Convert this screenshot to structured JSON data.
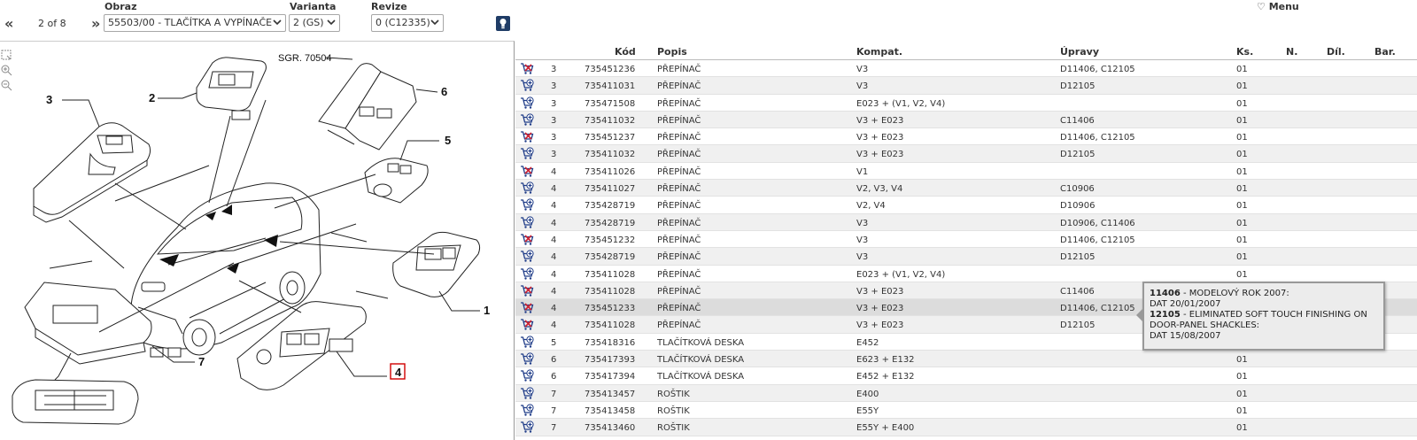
{
  "toolbar": {
    "obraz_label": "Obraz",
    "varianta_label": "Varianta",
    "revize_label": "Revize",
    "prev": "«",
    "next": "»",
    "page": "2 of 8",
    "obraz_value": "55503/00 - TLAČÍTKA A VYPÍNAČE",
    "varianta_value": "2 (GS)",
    "revize_value": "0 (C12335)",
    "menu": "♡ Menu"
  },
  "drawing": {
    "title": "SGR. 70504",
    "callouts": [
      "3",
      "2",
      "6",
      "5",
      "1",
      "7",
      "4"
    ]
  },
  "table": {
    "headers": {
      "code": "Kód",
      "desc": "Popis",
      "comp": "Kompat.",
      "mod": "Úpravy",
      "qty": "Ks.",
      "n": "N.",
      "dil": "Díl.",
      "bar": "Bar."
    },
    "rows": [
      {
        "pos": "3",
        "code": "735451236",
        "desc": "PŘEPÍNAČ",
        "comp": "V3",
        "mod": "D11406, C12105",
        "qty": "01",
        "cart": "x"
      },
      {
        "pos": "3",
        "code": "735411031",
        "desc": "PŘEPÍNAČ",
        "comp": "V3",
        "mod": "D12105",
        "qty": "01",
        "cart": "plus"
      },
      {
        "pos": "3",
        "code": "735471508",
        "desc": "PŘEPÍNAČ",
        "comp": "E023 + (V1, V2, V4)",
        "mod": "",
        "qty": "01",
        "cart": "plus"
      },
      {
        "pos": "3",
        "code": "735411032",
        "desc": "PŘEPÍNAČ",
        "comp": "V3 + E023",
        "mod": "C11406",
        "qty": "01",
        "cart": "plus"
      },
      {
        "pos": "3",
        "code": "735451237",
        "desc": "PŘEPÍNAČ",
        "comp": "V3 + E023",
        "mod": "D11406, C12105",
        "qty": "01",
        "cart": "x"
      },
      {
        "pos": "3",
        "code": "735411032",
        "desc": "PŘEPÍNAČ",
        "comp": "V3 + E023",
        "mod": "D12105",
        "qty": "01",
        "cart": "plus"
      },
      {
        "pos": "4",
        "code": "735411026",
        "desc": "PŘEPÍNAČ",
        "comp": "V1",
        "mod": "",
        "qty": "01",
        "cart": "x"
      },
      {
        "pos": "4",
        "code": "735411027",
        "desc": "PŘEPÍNAČ",
        "comp": "V2, V3, V4",
        "mod": "C10906",
        "qty": "01",
        "cart": "plus"
      },
      {
        "pos": "4",
        "code": "735428719",
        "desc": "PŘEPÍNAČ",
        "comp": "V2, V4",
        "mod": "D10906",
        "qty": "01",
        "cart": "plus"
      },
      {
        "pos": "4",
        "code": "735428719",
        "desc": "PŘEPÍNAČ",
        "comp": "V3",
        "mod": "D10906, C11406",
        "qty": "01",
        "cart": "plus"
      },
      {
        "pos": "4",
        "code": "735451232",
        "desc": "PŘEPÍNAČ",
        "comp": "V3",
        "mod": "D11406, C12105",
        "qty": "01",
        "cart": "x"
      },
      {
        "pos": "4",
        "code": "735428719",
        "desc": "PŘEPÍNAČ",
        "comp": "V3",
        "mod": "D12105",
        "qty": "01",
        "cart": "plus"
      },
      {
        "pos": "4",
        "code": "735411028",
        "desc": "PŘEPÍNAČ",
        "comp": "E023 + (V1, V2, V4)",
        "mod": "",
        "qty": "01",
        "cart": "plus"
      },
      {
        "pos": "4",
        "code": "735411028",
        "desc": "PŘEPÍNAČ",
        "comp": "V3 + E023",
        "mod": "C11406",
        "qty": "",
        "cart": "x"
      },
      {
        "pos": "4",
        "code": "735451233",
        "desc": "PŘEPÍNAČ",
        "comp": "V3 + E023",
        "mod": "D11406, C12105",
        "qty": "",
        "cart": "x"
      },
      {
        "pos": "4",
        "code": "735411028",
        "desc": "PŘEPÍNAČ",
        "comp": "V3 + E023",
        "mod": "D12105",
        "qty": "",
        "cart": "x"
      },
      {
        "pos": "5",
        "code": "735418316",
        "desc": "TLAČÍTKOVÁ DESKA",
        "comp": "E452",
        "mod": "",
        "qty": "",
        "cart": "plus"
      },
      {
        "pos": "6",
        "code": "735417393",
        "desc": "TLAČÍTKOVÁ DESKA",
        "comp": "E623 + E132",
        "mod": "",
        "qty": "01",
        "cart": "plus"
      },
      {
        "pos": "6",
        "code": "735417394",
        "desc": "TLAČÍTKOVÁ DESKA",
        "comp": "E452 + E132",
        "mod": "",
        "qty": "01",
        "cart": "plus"
      },
      {
        "pos": "7",
        "code": "735413457",
        "desc": "ROŠTIK",
        "comp": "E400",
        "mod": "",
        "qty": "01",
        "cart": "plus"
      },
      {
        "pos": "7",
        "code": "735413458",
        "desc": "ROŠTIK",
        "comp": "E55Y",
        "mod": "",
        "qty": "01",
        "cart": "plus"
      },
      {
        "pos": "7",
        "code": "735413460",
        "desc": "ROŠTIK",
        "comp": "E55Y + E400",
        "mod": "",
        "qty": "01",
        "cart": "plus"
      }
    ]
  },
  "tooltip": {
    "l1_code": "11406",
    "l1_text": " - MODELOVÝ ROK 2007:",
    "l2": "DAT 20/01/2007",
    "l3_code": "12105",
    "l3_text": " - ELIMINATED SOFT TOUCH FINISHING ON",
    "l4": "DOOR-PANEL SHACKLES:",
    "l5": "DAT 15/08/2007"
  },
  "colors": {
    "cart_blue": "#1f3c88",
    "cart_red": "#cc2233",
    "highlight_red": "#d00000"
  }
}
